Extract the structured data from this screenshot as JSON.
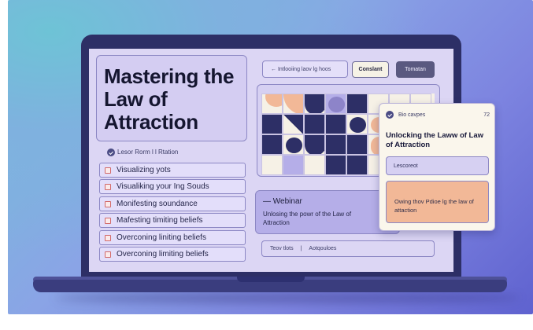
{
  "hero": {
    "title": "Mastering the Law of Attraction",
    "subtitle": "Lesor Rorm l l Rtation"
  },
  "checklist": [
    {
      "label": "Visualizing yots"
    },
    {
      "label": "Visualiking your Ing Souds"
    },
    {
      "label": "Monifesting soundance"
    },
    {
      "label": "Mafesting timiting beliefs"
    },
    {
      "label": "Overconing liniting beliefs"
    },
    {
      "label": "Overconing limiting beliefs"
    }
  ],
  "toolbar": {
    "search_text": "← Intlooiing laov lg hoos",
    "light_button": "Conslant",
    "dark_button": "Tomatan"
  },
  "webinar": {
    "title": "Webinar",
    "description": "Unlosing the powr of the Law of Attraction"
  },
  "footer_bar": {
    "left": "Teov tlots",
    "right": "Aotqouloes"
  },
  "card": {
    "header_label": "Bio cavpes",
    "header_number": "72",
    "title": "Unlocking the Laww of Law of Attraction",
    "input_text": "Lescoreot",
    "note_text": "Owing thov Pdioe lg the law of attaction"
  },
  "colors": {
    "dark_navy": "#2d2f66",
    "lavender": "#d6d0f2",
    "peach": "#f2b897",
    "cream": "#f6f1e6",
    "purple": "#b5aee8"
  }
}
